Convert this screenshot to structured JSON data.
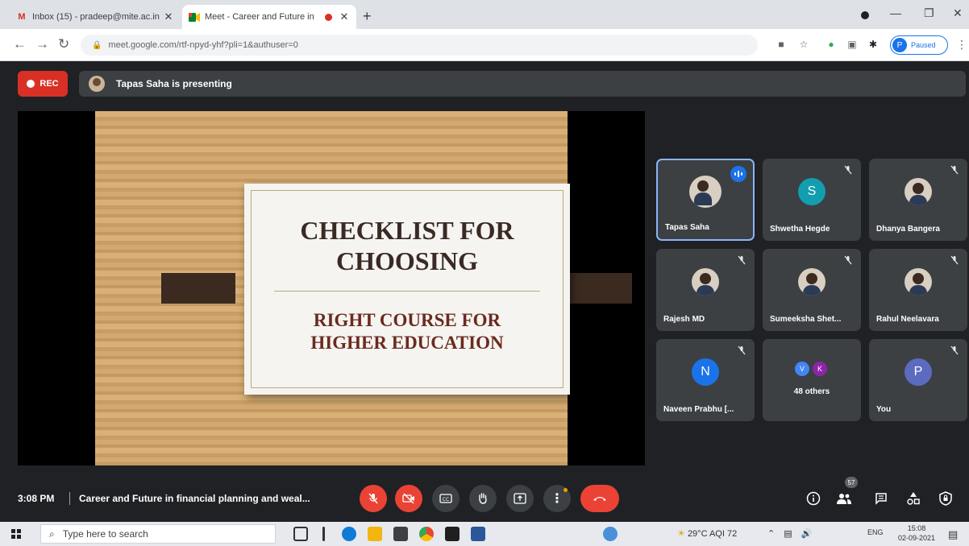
{
  "browser": {
    "tabs": [
      {
        "title": "Inbox (15) - pradeep@mite.ac.in",
        "favicon": "gmail-icon"
      },
      {
        "title": "Meet - Career and Future in",
        "favicon": "meet-icon"
      }
    ],
    "url": "meet.google.com/rtf-npyd-yhf?pli=1&authuser=0",
    "profile_initial": "P",
    "profile_status": "Paused"
  },
  "meet": {
    "rec_label": "REC",
    "presenting_text": "Tapas Saha is presenting",
    "slide": {
      "title_line1": "CHECKLIST FOR",
      "title_line2": "CHOOSING",
      "subtitle_line1": "RIGHT COURSE FOR",
      "subtitle_line2": "HIGHER EDUCATION"
    },
    "participants": [
      {
        "name": "Tapas Saha",
        "avatar": "photo",
        "speaking": true
      },
      {
        "name": "Shwetha Hegde",
        "initial": "S",
        "color": "#129eaf"
      },
      {
        "name": "Dhanya Bangera",
        "avatar": "photo"
      },
      {
        "name": "Rajesh MD",
        "avatar": "photo"
      },
      {
        "name": "Sumeeksha Shet...",
        "avatar": "photo"
      },
      {
        "name": "Rahul Neelavara",
        "avatar": "photo"
      },
      {
        "name": "Naveen Prabhu [...",
        "initial": "N",
        "color": "#1a73e8"
      },
      {
        "name": "48 others",
        "initials": [
          "V",
          "K"
        ],
        "colors": [
          "#4285f4",
          "#8e24aa"
        ]
      },
      {
        "name": "You",
        "initial": "P",
        "color": "#5c6bc0"
      }
    ],
    "time": "3:08 PM",
    "meeting_title": "Career and Future in financial planning and weal...",
    "participant_count": "57"
  },
  "taskbar": {
    "search_placeholder": "Type here to search",
    "weather": "29°C  AQI 72",
    "lang": "ENG",
    "time": "15:08",
    "date": "02-09-2021"
  }
}
